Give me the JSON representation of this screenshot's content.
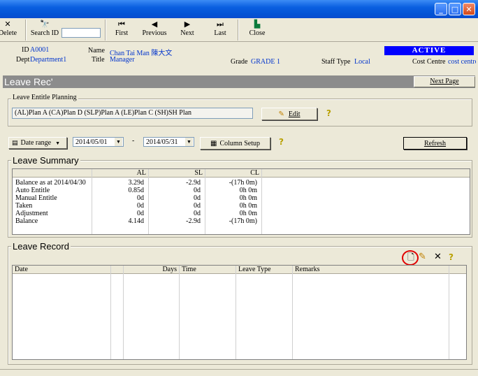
{
  "toolbar": {
    "delete_label": "Delete",
    "search_id_label": "Search ID",
    "search_value": "",
    "first_label": "First",
    "previous_label": "Previous",
    "next_label": "Next",
    "last_label": "Last",
    "close_label": "Close"
  },
  "employee": {
    "id_label": "ID",
    "id_value": "A0001",
    "dept_label": "Dept",
    "dept_value": "Department1",
    "name_label": "Name",
    "name_value": "Chan Tai Man 陳大文",
    "title_label": "Title",
    "title_value": "Manager",
    "grade_label": "Grade",
    "grade_value": "GRADE 1",
    "staff_type_label": "Staff Type",
    "staff_type_value": "Local",
    "cost_centre_label": "Cost Centre",
    "cost_centre_value": "cost centre",
    "status": "ACTIVE"
  },
  "header": {
    "title": "Leave Rec'",
    "next_page_label": "Next Page"
  },
  "entitle": {
    "group_title": "Leave Entitle Planning",
    "plan_value": "(AL)Plan A (CA)Plan D (SLP)Plan A (LE)Plan C (SH)SH Plan",
    "edit_label": "Edit"
  },
  "filter": {
    "range_type": "Date range",
    "from_date": "2014/05/01",
    "dash": "-",
    "to_date": "2014/05/31",
    "column_setup_label": "Column Setup",
    "refresh_label": "Refresh"
  },
  "summary": {
    "group_title": "Leave Summary",
    "columns": [
      "",
      "AL",
      "SL",
      "CL"
    ],
    "rows": [
      {
        "label": "Balance as at 2014/04/30",
        "al": "3.29d",
        "sl": "-2.9d",
        "cl": "-(17h 0m)"
      },
      {
        "label": "Auto Entitle",
        "al": "0.85d",
        "sl": "0d",
        "cl": "0h 0m"
      },
      {
        "label": "Manual Entitle",
        "al": "0d",
        "sl": "0d",
        "cl": "0h 0m"
      },
      {
        "label": "Taken",
        "al": "0d",
        "sl": "0d",
        "cl": "0h 0m"
      },
      {
        "label": "Adjustment",
        "al": "0d",
        "sl": "0d",
        "cl": "0h 0m"
      },
      {
        "label": "Balance",
        "al": "4.14d",
        "sl": "-2.9d",
        "cl": "-(17h 0m)"
      }
    ]
  },
  "record": {
    "group_title": "Leave Record",
    "columns": [
      "Date",
      "",
      "Days",
      "Time",
      "Leave Type",
      "Remarks"
    ]
  },
  "colors": {
    "titlebar": "#0a5fe0",
    "active_badge": "#0000ff",
    "value_text": "#0033cc",
    "highlight_circle": "#e00000"
  }
}
